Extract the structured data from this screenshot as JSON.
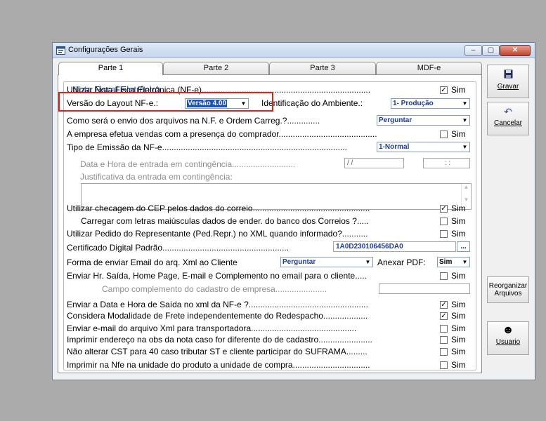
{
  "window": {
    "title": "Configurações Gerais",
    "controls": {
      "minimize": "–",
      "maximize": "▢",
      "close": "✕"
    }
  },
  "tabs": [
    "Parte 1",
    "Parte 2",
    "Parte 3",
    "MDF-e"
  ],
  "group_title": "Nota Fiscal Eletrônica",
  "rows": [
    {
      "label": "Utilizar Nota Fisca Eletrônica (NF-e)........................................................................",
      "check": "✓",
      "sim": "Sim"
    },
    {
      "label": "Versão do Layout NF-e.:",
      "combo": "Versão 4.00",
      "label2": "Identificação do Ambiente.:",
      "combo2": "1- Produção"
    },
    {
      "label": "Como será o envio dos arquivos na N.F. e Ordem Carreg.?..............",
      "combo": "Perguntar"
    },
    {
      "label": "A empresa efetua vendas com a presença do comprador..........................................",
      "check": "",
      "sim": "Sim"
    },
    {
      "label": "Tipo de Emissão da NF-e...............................................................................",
      "combo": "1-Normal"
    },
    {
      "label": "Data e Hora de entrada em contingência...........................",
      "date": "/  /",
      "time": ":  :"
    },
    {
      "label": "Justificativa da entrada em contingência:"
    },
    {
      "label": "Utilizar checagem do CEP pelos dados do correio..................................................",
      "check": "✓",
      "sim": "Sim"
    },
    {
      "label": "Carregar com letras maiúsculas dados de ender. do banco dos Correios ?.....",
      "check": "",
      "sim": "Sim"
    },
    {
      "label": "Utilizar Pedido do Representante (Ped.Repr.) no XML quando informado?...........",
      "check": "",
      "sim": "Sim"
    },
    {
      "label": "Certificado Digital Padrão......................................................",
      "field": "1A0D230106456DA0",
      "btn": "..."
    },
    {
      "label": "Forma de enviar Email do arq. Xml ao Cliente",
      "combo": "Perguntar",
      "label2": "Anexar PDF:",
      "combo2": "Sim"
    },
    {
      "label": "Enviar Hr. Saída, Home Page, E-mail e Complemento no email para o cliente.....",
      "check": "",
      "sim": "Sim"
    },
    {
      "label": "Campo complemento do cadastro de empresa......................"
    },
    {
      "label": "Enviar a Data e Hora de Saída no xml da NF-e ?...................................................",
      "check": "✓",
      "sim": "Sim"
    },
    {
      "label": "Considera Modalidade de Frete independentemente do Redespacho...................",
      "check": "✓",
      "sim": "Sim"
    },
    {
      "label": "Enviar e-mail do arquivo Xml para transportadora.............................................",
      "check": "",
      "sim": "Sim"
    },
    {
      "label": "Imprimir endereço na obs da nota caso for diferente do de cadastro.......................",
      "check": "",
      "sim": "Sim"
    },
    {
      "label": "Não alterar CST para 40 caso tributar ST e cliente participar do SUFRAMA.........",
      "check": "",
      "sim": "Sim"
    },
    {
      "label": "Imprimir na Nfe na unidade do produto a unidade de compra.................................",
      "check": "",
      "sim": "Sim"
    }
  ],
  "side": {
    "save": "Gravar",
    "cancel": "Cancelar",
    "reorg_line1": "Reorganizar",
    "reorg_line2": "Arquivos",
    "user": "Usuario"
  },
  "colors": {
    "highlight_box": "#e0201a",
    "group_title": "#1b52a8",
    "combo_text": "#1b3aa8"
  }
}
